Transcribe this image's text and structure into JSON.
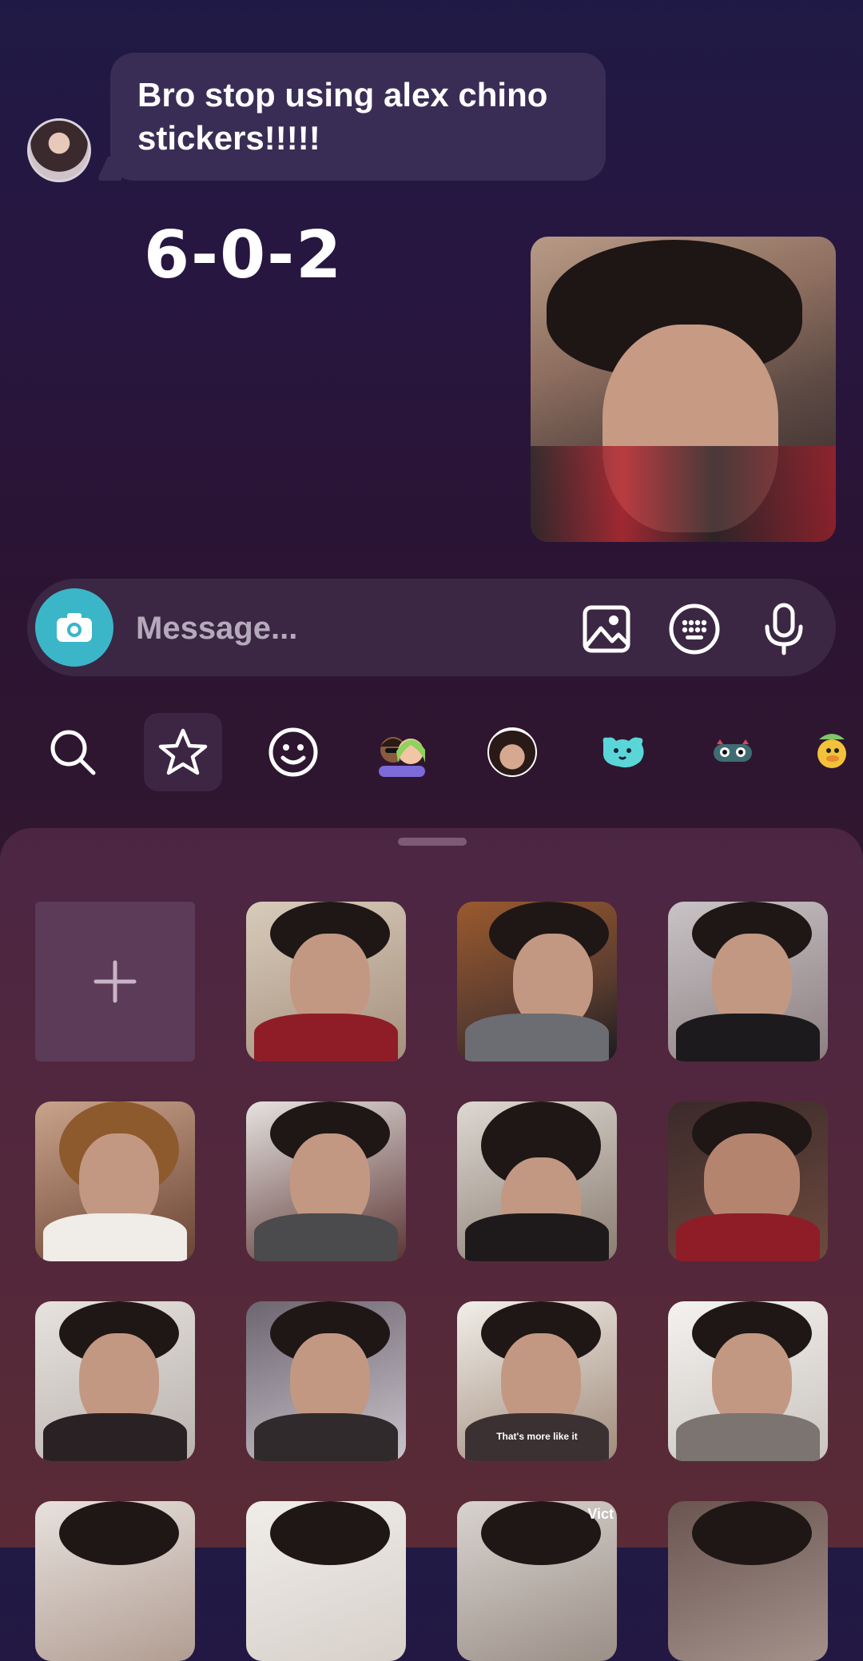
{
  "chat": {
    "incoming_message": "Bro stop using alex chino stickers!!!!!",
    "score_text": "6-0-2"
  },
  "composer": {
    "placeholder": "Message..."
  },
  "sticker_tabs": [
    {
      "name": "search"
    },
    {
      "name": "favorites",
      "active": true
    },
    {
      "name": "emoji"
    },
    {
      "name": "avatars"
    },
    {
      "name": "custom-face"
    },
    {
      "name": "blob-pack"
    },
    {
      "name": "monster-pack"
    },
    {
      "name": "duck-pack"
    }
  ],
  "sticker_grid": {
    "add_label": "+",
    "captions": [
      "That's more like it",
      "Vict"
    ]
  },
  "colors": {
    "accent_camera": "#3ab6c8",
    "bubble": "#3a2d55",
    "composer": "#3b2743"
  }
}
